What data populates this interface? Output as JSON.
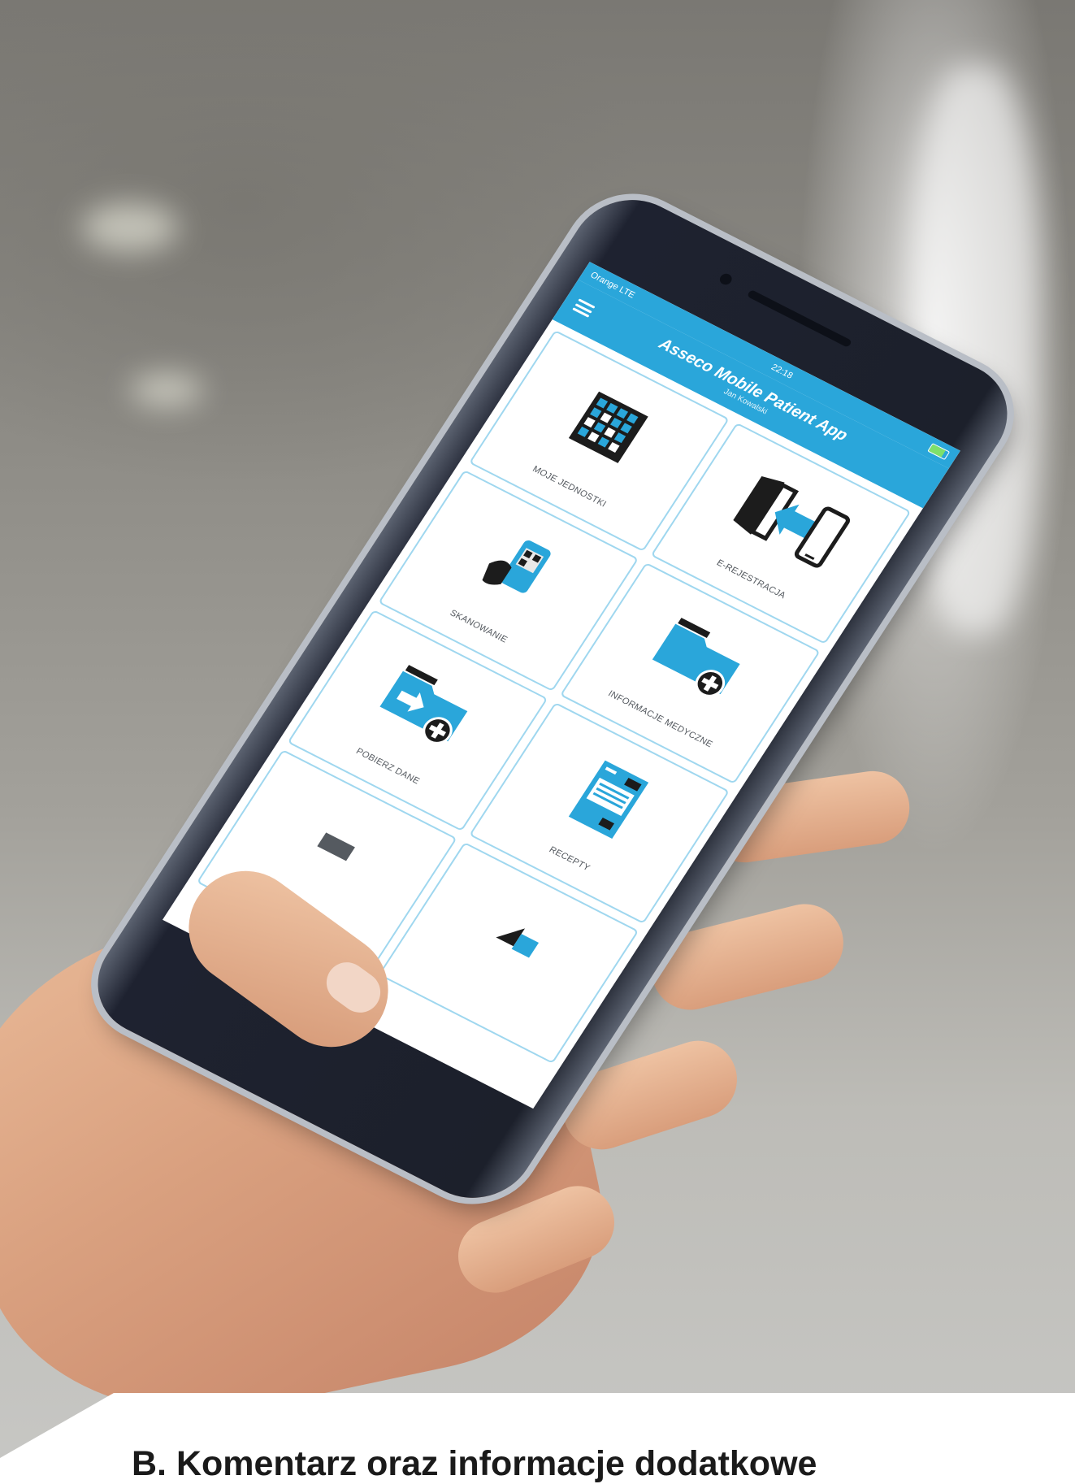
{
  "caption": {
    "text": "B. Komentarz oraz informacje dodatkowe"
  },
  "phone": {
    "status_bar": {
      "carrier": "Orange LTE",
      "time": "22:18"
    },
    "app": {
      "title": "Asseco Mobile Patient App",
      "subtitle": "Jan Kowalski",
      "menu_icon": "hamburger-menu-icon"
    },
    "tiles": [
      {
        "label": "MOJE JEDNOSTKI",
        "icon": "calendar-grid-icon"
      },
      {
        "label": "E-REJESTRACJA",
        "icon": "door-to-phone-icon"
      },
      {
        "label": "SKANOWANIE",
        "icon": "qr-scan-hand-icon"
      },
      {
        "label": "INFORMACJE MEDYCZNE",
        "icon": "medical-folder-plus-icon"
      },
      {
        "label": "POBIERZ DANE",
        "icon": "import-folder-plus-icon"
      },
      {
        "label": "RECEPTY",
        "icon": "prescription-document-icon"
      },
      {
        "label": "",
        "icon": "partial-tile-icon"
      },
      {
        "label": "",
        "icon": "partial-folder-icon"
      }
    ]
  },
  "colors": {
    "app_accent": "#2aa6da",
    "tile_border": "#9fd7ef",
    "icon_dark": "#1c1c1c"
  }
}
